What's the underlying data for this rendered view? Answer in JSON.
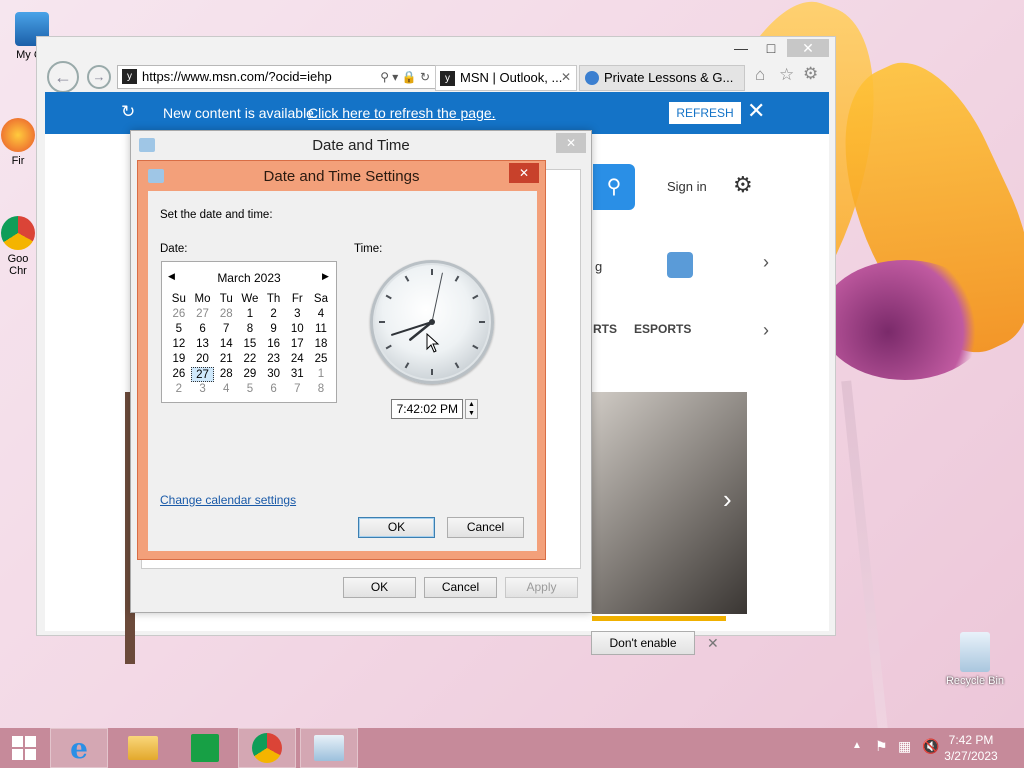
{
  "desktop": {
    "icons": [
      {
        "label": "My Co"
      },
      {
        "label": "Fir"
      },
      {
        "label": "Goo Chr"
      },
      {
        "label": "Recycle Bin"
      }
    ]
  },
  "browser": {
    "url": "https://www.msn.com/?ocid=iehp",
    "tabs": [
      {
        "label": "MSN | Outlook, ..."
      },
      {
        "label": "Private Lessons & G..."
      }
    ],
    "infobar": {
      "message": "New content is available.",
      "link": "Click here to refresh the page.",
      "button": "REFRESH"
    },
    "page": {
      "signin": "Sign in",
      "nav_items": [
        "RTS",
        "ESPORTS"
      ],
      "snippet": "g",
      "dont_enable": "Don't enable"
    }
  },
  "date_time_dialog": {
    "title": "Date and Time",
    "ok": "OK",
    "cancel": "Cancel",
    "apply": "Apply"
  },
  "settings_dialog": {
    "title": "Date and Time Settings",
    "instruction": "Set the date and time:",
    "date_label": "Date:",
    "time_label": "Time:",
    "month": "March 2023",
    "weekdays": [
      "Su",
      "Mo",
      "Tu",
      "We",
      "Th",
      "Fr",
      "Sa"
    ],
    "weeks": [
      [
        "26",
        "27",
        "28",
        "1",
        "2",
        "3",
        "4"
      ],
      [
        "5",
        "6",
        "7",
        "8",
        "9",
        "10",
        "11"
      ],
      [
        "12",
        "13",
        "14",
        "15",
        "16",
        "17",
        "18"
      ],
      [
        "19",
        "20",
        "21",
        "22",
        "23",
        "24",
        "25"
      ],
      [
        "26",
        "27",
        "28",
        "29",
        "30",
        "31",
        "1"
      ],
      [
        "2",
        "3",
        "4",
        "5",
        "6",
        "7",
        "8"
      ]
    ],
    "selected_day": "27",
    "time_value": "7:42:02 PM",
    "change_calendar": "Change calendar settings",
    "ok": "OK",
    "cancel": "Cancel",
    "clock": {
      "hour": 7,
      "minute": 42,
      "second": 2
    }
  },
  "taskbar": {
    "time": "7:42 PM",
    "date": "3/27/2023"
  },
  "colors": {
    "accent": "#1473c7",
    "dialog_border": "#f3a07a"
  }
}
